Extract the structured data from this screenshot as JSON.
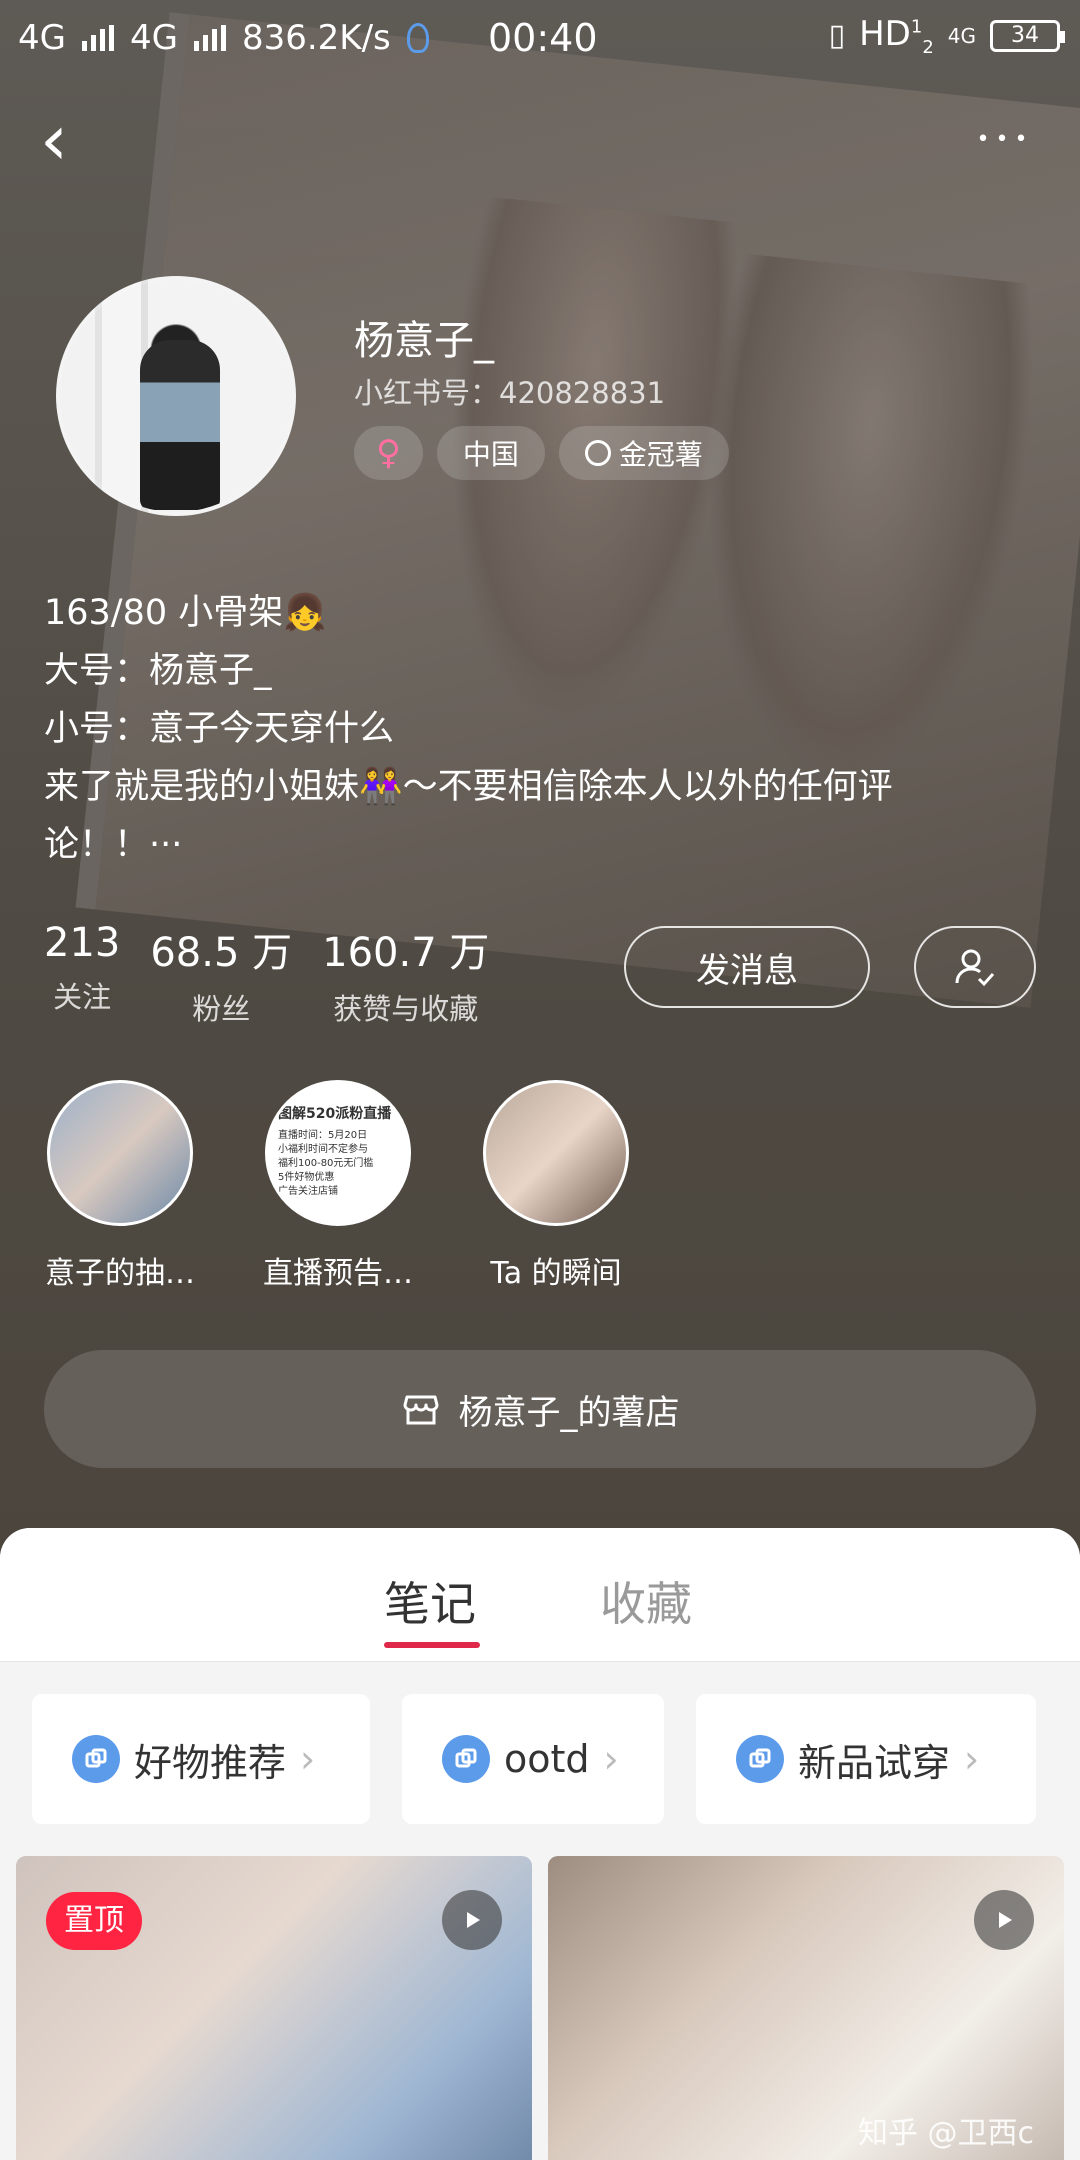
{
  "status_bar": {
    "network_left": "4G",
    "network_right": "4G",
    "speed": "836.2K/s",
    "time": "00:40",
    "hd": "HD",
    "hd_sup": "1",
    "hd_sub": "2",
    "net_4g": "4G",
    "battery": "34"
  },
  "nav": {
    "back_glyph": "‹",
    "more_glyph": "•••"
  },
  "profile": {
    "name": "杨意子_",
    "red_id": "小红书号：420828831",
    "tags": {
      "gender": "♀",
      "location": "中国",
      "level": "金冠薯"
    },
    "bio": [
      "163/80 小骨架👧",
      "大号：杨意子_",
      "小号：意子今天穿什么",
      "来了就是我的小姐妹👭～不要相信除本人以外的任何评",
      "论！！···"
    ]
  },
  "stats": [
    {
      "num": "213",
      "label": "关注"
    },
    {
      "num": "68.5 万",
      "label": "粉丝"
    },
    {
      "num": "160.7 万",
      "label": "获赞与收藏"
    }
  ],
  "actions": {
    "message": "发消息"
  },
  "highlights": [
    {
      "caption": "意子的抽…"
    },
    {
      "caption": "直播预告…",
      "inner_title": "图解520派粉直播",
      "inner_lines": [
        "直播时间：5月20日",
        "小福利时间不定参与",
        "福利100-80元无门槛",
        "5件好物优惠",
        "广告关注店铺"
      ]
    },
    {
      "caption": "Ta 的瞬间"
    }
  ],
  "store": {
    "label": "杨意子_的薯店",
    "icon": "store-icon"
  },
  "tabs": [
    {
      "label": "笔记",
      "active": true
    },
    {
      "label": "收藏",
      "active": false
    }
  ],
  "collections": [
    {
      "label": "好物推荐"
    },
    {
      "label": "ootd"
    },
    {
      "label": "新品试穿"
    }
  ],
  "notes": [
    {
      "badge": "置顶"
    },
    {
      "badge": ""
    }
  ],
  "watermark": "知乎 @卫西c",
  "colors": {
    "accent": "#ff2442",
    "tab_underline": "#e0294a",
    "collection_icon": "#5b9bea"
  }
}
